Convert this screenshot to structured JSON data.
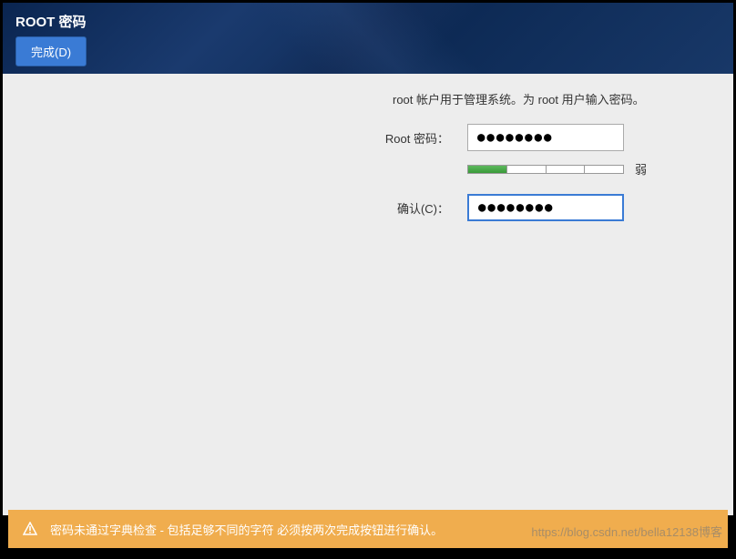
{
  "header": {
    "title": "ROOT 密码",
    "done_button": "完成(D)"
  },
  "form": {
    "description": "root 帐户用于管理系统。为 root 用户输入密码。",
    "password_label": "Root 密码：",
    "password_value": "●●●●●●●●",
    "confirm_label": "确认(C)：",
    "confirm_value": "●●●●●●●●",
    "strength_label": "弱"
  },
  "warning": {
    "message": "密码未通过字典检查 - 包括足够不同的字符 必须按两次完成按钮进行确认。"
  },
  "watermark": "https://blog.csdn.net/bella12138博客"
}
